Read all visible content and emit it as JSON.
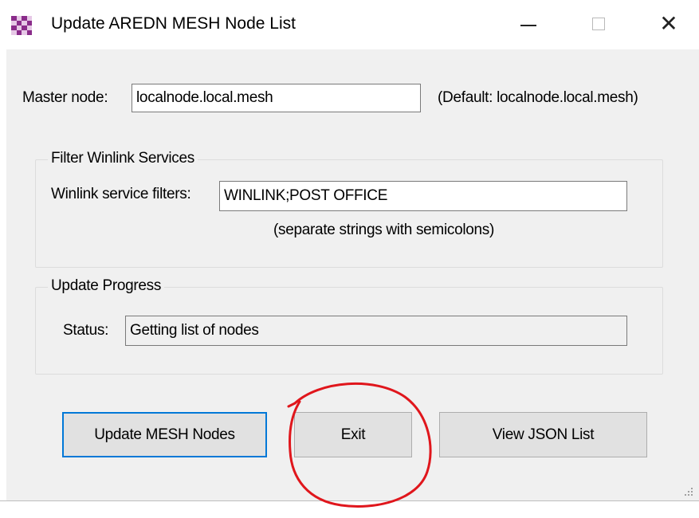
{
  "window": {
    "title": "Update AREDN MESH Node List",
    "icon": "app-checker-icon",
    "controls": {
      "minimize": "minimize-icon",
      "maximize": "maximize-icon",
      "close": "close-icon"
    }
  },
  "master": {
    "label": "Master node:",
    "value": "localnode.local.mesh",
    "hint": "(Default: localnode.local.mesh)"
  },
  "filter_group": {
    "title": "Filter Winlink Services",
    "label": "Winlink service filters:",
    "value": "WINLINK;POST OFFICE",
    "hint": "(separate strings with semicolons)"
  },
  "progress_group": {
    "title": "Update Progress",
    "status_label": "Status:",
    "status_value": "Getting list of nodes"
  },
  "buttons": {
    "update": "Update MESH Nodes",
    "exit": "Exit",
    "view_json": "View JSON List"
  },
  "colors": {
    "client_bg": "#f0f0f0",
    "focus_border": "#0078d7",
    "annotation": "#e0161c"
  }
}
